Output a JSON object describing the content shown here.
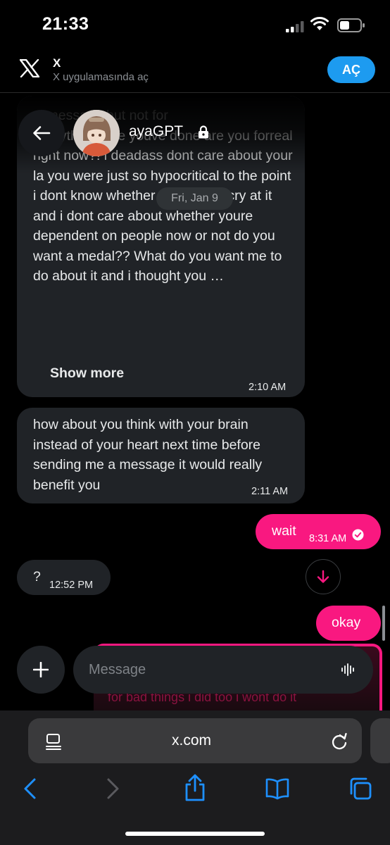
{
  "status_bar": {
    "time": "21:33"
  },
  "banner": {
    "app_name": "X",
    "subtitle": "X uygulamasında aç",
    "open_label": "AÇ"
  },
  "chat": {
    "title": "ayaGPT",
    "date_separator": "Fri, Jan 9",
    "messages": [
      {
        "text": "…message but not for\neverything else youve done are you forreal right now?! i deadass dont care about your la           you were just so hypocritical to the point i dont know whether to laugh or cry at it and i dont care about whether youre dependent on people now or not do you want a medal?? What do you want me to do about it and i thought you …",
        "show_more": "Show more",
        "time": "2:10 AM"
      },
      {
        "text": "how about you think with your brain instead of your heart next time before sending me a message it would really benefit you",
        "time": "2:11 AM"
      },
      {
        "text": "wait",
        "time": "8:31 AM",
        "outgoing": true
      },
      {
        "text": "?",
        "time": "12:52 PM"
      },
      {
        "text": "okay",
        "outgoing": true
      }
    ],
    "behind_text": "for bad things i did too i wont do it"
  },
  "composer": {
    "placeholder": "Message"
  },
  "browser": {
    "url": "x.com"
  },
  "colors": {
    "accent": "#f91880",
    "link_blue": "#1d9bf0",
    "bubble": "#202327"
  }
}
